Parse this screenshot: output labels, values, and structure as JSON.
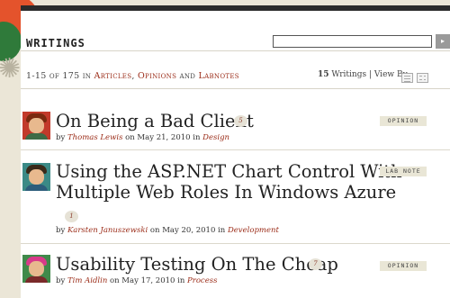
{
  "section": {
    "title": "WRITINGS"
  },
  "search": {
    "value": "",
    "button_glyph": "▸"
  },
  "summary": {
    "range": "1-15 of 175 in ",
    "cat1": "Articles",
    "sep1": ", ",
    "cat2": "Opinions",
    "sep2": " and ",
    "cat3": "Labnotes",
    "count": "15",
    "count_label": " Writings | View By"
  },
  "posts": [
    {
      "title": "On Being a Bad Client",
      "comments": "5",
      "by": "by ",
      "author": "Thomas Lewis",
      "on": " on May 21, 2010 in ",
      "category": "Design",
      "tag": "OPINION",
      "avatar": {
        "bg": "#c23a2b",
        "hair": "#7a2a10",
        "body": "#3e6b46"
      }
    },
    {
      "title_line1": "Using the ASP.NET Chart Control With",
      "title_line2": "Multiple Web Roles In Windows Azure",
      "comments": "1",
      "by": "by ",
      "author": "Karsten Januszewski",
      "on": " on May 20, 2010 in ",
      "category": "Development",
      "tag": "LAB NOTE",
      "avatar": {
        "bg": "#3b8a86",
        "hair": "#3a2a1a",
        "body": "#2d5d7b"
      }
    },
    {
      "title": "Usability Testing On The Cheap",
      "comments": "7",
      "by": "by ",
      "author": "Tim Aidlin",
      "on": " on May 17, 2010 in ",
      "category": "Process",
      "tag": "OPINION",
      "avatar": {
        "bg": "#3f8a4a",
        "hair": "#d83a8a",
        "body": "#7a2a2a"
      }
    }
  ]
}
